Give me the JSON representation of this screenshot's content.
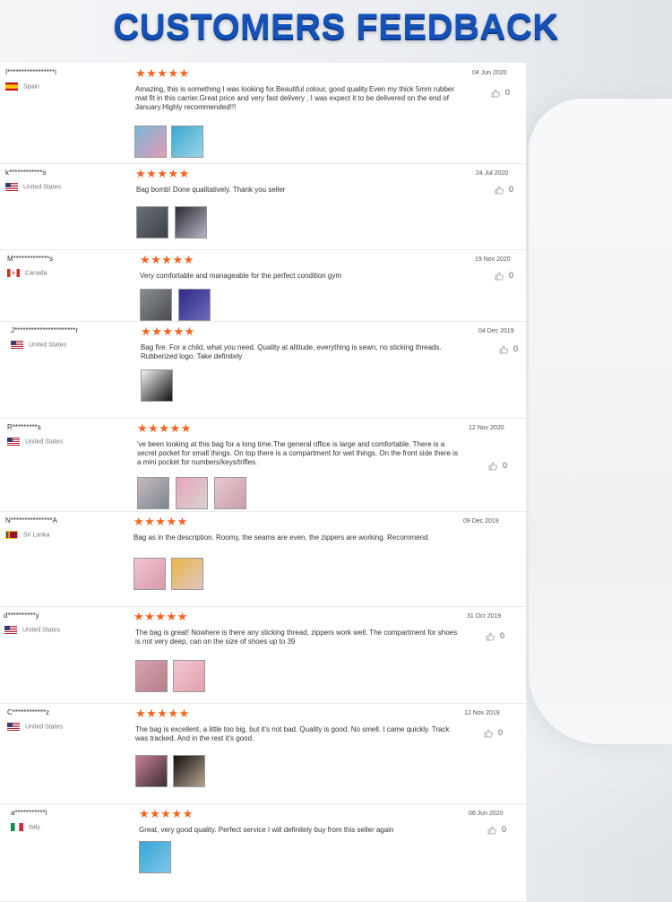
{
  "title": "CUSTOMERS FEEDBACK",
  "colors": {
    "accent": "#1452b9",
    "star": "#f5641e"
  },
  "reviews": [
    {
      "user": "I*****************i",
      "country": "Spain",
      "flag": "spain",
      "stars": "★★★★★",
      "date": "04 Jun 2020",
      "text": "Amazing, this is something I was looking for.Beautiful colour, good quality.Even my thick 5mm rubber mat fit in this carrier.Great price and very fast delivery , I was expect it to be delivered on the end of January.Highly recommended!!!",
      "likes": "0",
      "photos": [
        {
          "c1": "#7ab8d8",
          "c2": "#e39ab7"
        },
        {
          "c1": "#3aa7cf",
          "c2": "#9bd4e6"
        }
      ]
    },
    {
      "user": "k************s",
      "country": "United States",
      "flag": "us",
      "stars": "★★★★★",
      "date": "24 Jul 2020",
      "text": "Bag bomb! Done qualitatively. Thank you seller",
      "likes": "0",
      "photos": [
        {
          "c1": "#6b7078",
          "c2": "#3d4148"
        },
        {
          "c1": "#2a2c33",
          "c2": "#b9b3c7"
        }
      ]
    },
    {
      "user": "M*************s",
      "country": "Canada",
      "flag": "canada",
      "stars": "★★★★★",
      "date": "19 Nov 2020",
      "text": "Very comfortable and manageable for the perfect condition gym",
      "likes": "0",
      "photos": [
        {
          "c1": "#8a8d90",
          "c2": "#4a4c52"
        },
        {
          "c1": "#2d2a88",
          "c2": "#6f6ab8"
        }
      ]
    },
    {
      "user": "J**********************r",
      "country": "United States",
      "flag": "us",
      "stars": "★★★★★",
      "date": "04 Dec 2019",
      "text": "Bag fire. For a child, what you need. Quality at altitude, everything is sewn, no sticking threads. Rubberized logo. Take definitely",
      "likes": "0",
      "photos": [
        {
          "c1": "#f2f2f2",
          "c2": "#111111"
        }
      ]
    },
    {
      "user": "R*********s",
      "country": "United States",
      "flag": "us",
      "stars": "★★★★★",
      "date": "12 Nov 2020",
      "text": "'ve been looking at this bag for a long time.The general office is large and comfortable. There is a secret pocket for small things. On top there is a compartment for wet things. On the front side there is a mini pocket for numbers/keys/trifles.",
      "likes": "0",
      "photos": [
        {
          "c1": "#c9b9c0",
          "c2": "#7a8591"
        },
        {
          "c1": "#e9a5bb",
          "c2": "#d8d2cf"
        },
        {
          "c1": "#e7c8cf",
          "c2": "#c79ea9"
        }
      ]
    },
    {
      "user": "N***************A",
      "country": "Sri Lanka",
      "flag": "srilanka",
      "stars": "★★★★★",
      "date": "09 Dec 2019",
      "text": "Bag as in the description. Roomy, the seams are even, the zippers are working. Recommend.",
      "likes": "",
      "photos": [
        {
          "c1": "#f2c3cf",
          "c2": "#d89aab"
        },
        {
          "c1": "#e9b64a",
          "c2": "#e0c6c4"
        }
      ]
    },
    {
      "user": "d**********y",
      "country": "United States",
      "flag": "us",
      "stars": "★★★★★",
      "date": "31 Oct 2019",
      "text": "The bag is great! Nowhere is there any sticking thread, zippers work well. The compartment for shoes is not very deep, can on the size of shoes up to 39",
      "likes": "0",
      "photos": [
        {
          "c1": "#d9a2ad",
          "c2": "#b67f8c"
        },
        {
          "c1": "#f4c6cf",
          "c2": "#e0a0ae"
        }
      ]
    },
    {
      "user": "C************z",
      "country": "United States",
      "flag": "us",
      "stars": "★★★★★",
      "date": "12 Nov 2019",
      "text": "The bag is excellent, a little too big, but it's not bad. Quality is good. No smell. I came quickly. Track was tracked. And in the rest it's good.",
      "likes": "0",
      "photos": [
        {
          "c1": "#c87e93",
          "c2": "#3b2f33"
        },
        {
          "c1": "#111111",
          "c2": "#b8a28e"
        }
      ]
    },
    {
      "user": "a***********i",
      "country": "Italy",
      "flag": "italy",
      "stars": "★★★★★",
      "date": "06 Jun 2020",
      "text": "Great, very good quality. Perfect service I will definitely buy from this seller again",
      "likes": "0",
      "photos": [
        {
          "c1": "#3aa4d6",
          "c2": "#7cc6e8"
        }
      ]
    }
  ]
}
